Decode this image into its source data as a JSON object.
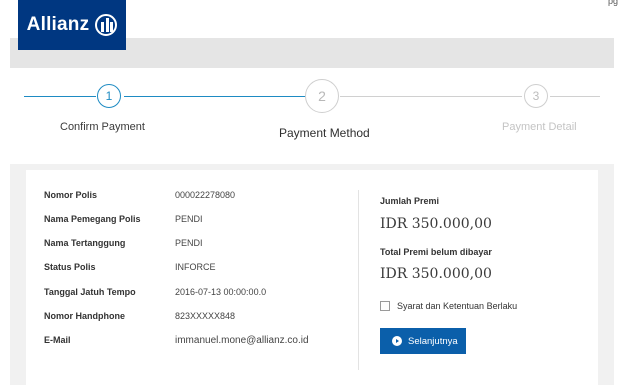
{
  "brand": {
    "name": "Allianz",
    "logo_icon": "allianz-eagle-icon",
    "color": "#003781"
  },
  "page_indicator": "pg",
  "steps": [
    {
      "number": "1",
      "label": "Confirm Payment",
      "state": "done"
    },
    {
      "number": "2",
      "label": "Payment Method",
      "state": "current"
    },
    {
      "number": "3",
      "label": "Payment Detail",
      "state": "upcoming"
    }
  ],
  "policy": {
    "rows": [
      {
        "key": "Nomor Polis",
        "value": "000022278080"
      },
      {
        "key": "Nama Pemegang Polis",
        "value": "PENDI"
      },
      {
        "key": "Nama Tertanggung",
        "value": "PENDI"
      },
      {
        "key": "Status Polis",
        "value": "INFORCE"
      },
      {
        "key": "Tanggal Jatuh Tempo",
        "value": "2016-07-13 00:00:00.0"
      },
      {
        "key": "Nomor Handphone",
        "value": "823XXXXX848"
      },
      {
        "key": "E-Mail",
        "value": "immanuel.mone@allianz.co.id"
      }
    ]
  },
  "summary": {
    "premium_label": "Jumlah Premi",
    "premium_value": "IDR 350.000,00",
    "unpaid_label": "Total Premi belum dibayar",
    "unpaid_value": "IDR 350.000,00",
    "terms_label": "Syarat dan Ketentuan Berlaku",
    "terms_checked": false,
    "next_button": "Selanjutnya",
    "next_icon": "arrow-right-circle-icon"
  },
  "colors": {
    "accent": "#1e8bc3",
    "button": "#0b5faa"
  }
}
